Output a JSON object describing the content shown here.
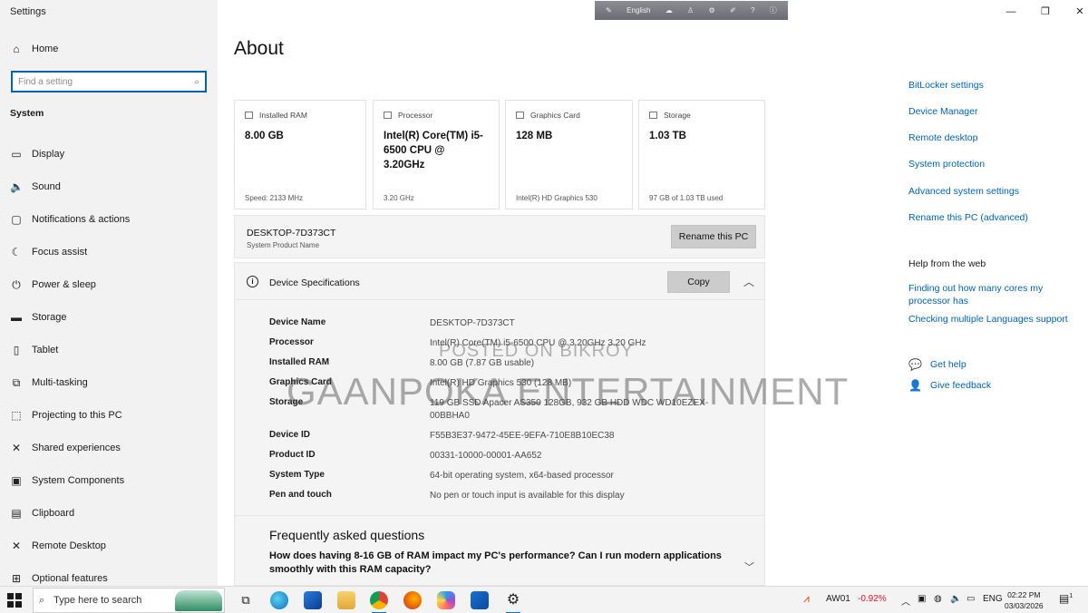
{
  "window": {
    "title": "Settings",
    "controls": [
      "—",
      "❐",
      "✕"
    ]
  },
  "langbar": {
    "language": "English"
  },
  "sidebar": {
    "home_label": "Home",
    "search_placeholder": "Find a setting",
    "section": "System",
    "items": [
      {
        "label": "Display",
        "icon": "monitor-icon",
        "glyph": "▭"
      },
      {
        "label": "Sound",
        "icon": "speaker-icon",
        "glyph": "🔈"
      },
      {
        "label": "Notifications & actions",
        "icon": "notification-icon",
        "glyph": "▢"
      },
      {
        "label": "Focus assist",
        "icon": "moon-icon",
        "glyph": "☾"
      },
      {
        "label": "Power & sleep",
        "icon": "power-icon",
        "glyph": "⏻"
      },
      {
        "label": "Storage",
        "icon": "storage-icon",
        "glyph": "▬"
      },
      {
        "label": "Tablet",
        "icon": "tablet-icon",
        "glyph": "▯"
      },
      {
        "label": "Multi-tasking",
        "icon": "multitask-icon",
        "glyph": "⧉"
      },
      {
        "label": "Projecting to this PC",
        "icon": "projector-icon",
        "glyph": "⬚"
      },
      {
        "label": "Shared experiences",
        "icon": "shared-icon",
        "glyph": "✕"
      },
      {
        "label": "System Components",
        "icon": "components-icon",
        "glyph": "▣"
      },
      {
        "label": "Clipboard",
        "icon": "clipboard-icon",
        "glyph": "▤"
      },
      {
        "label": "Remote Desktop",
        "icon": "remote-icon",
        "glyph": "✕"
      },
      {
        "label": "Optional features",
        "icon": "features-icon",
        "glyph": "⊞"
      }
    ]
  },
  "main": {
    "title": "About",
    "cards": [
      {
        "label": "Installed RAM",
        "value": "8.00 GB",
        "sub": "Speed: 2133 MHz"
      },
      {
        "label": "Processor",
        "value": "Intel(R) Core(TM) i5-6500 CPU @ 3.20GHz",
        "sub": "3.20 GHz"
      },
      {
        "label": "Graphics Card",
        "value": "128 MB",
        "sub": "Intel(R) HD Graphics 530"
      },
      {
        "label": "Storage",
        "value": "1.03 TB",
        "sub": "97 GB of 1.03 TB used"
      }
    ],
    "pc": {
      "name": "DESKTOP-7D373CT",
      "sub": "System Product Name",
      "rename_label": "Rename this PC"
    },
    "specs": {
      "title": "Device Specifications",
      "copy_label": "Copy",
      "rows": [
        {
          "k": "Device Name",
          "v": "DESKTOP-7D373CT"
        },
        {
          "k": "Processor",
          "v": "Intel(R) Core(TM) i5-6500 CPU @ 3.20GHz   3.20 GHz"
        },
        {
          "k": "Installed RAM",
          "v": "8.00 GB (7.87 GB usable)"
        },
        {
          "k": "Graphics Card",
          "v": "Intel(R) HD Graphics 530 (128 MB)"
        },
        {
          "k": "Storage",
          "v": "119 GB SSD Apacer AS350 128GB, 932 GB HDD WDC WD10EZEX-00BBHA0"
        },
        {
          "k": "Device ID",
          "v": "F55B3E37-9472-45EE-9EFA-710E8B10EC38"
        },
        {
          "k": "Product ID",
          "v": "00331-10000-00001-AA652"
        },
        {
          "k": "System Type",
          "v": "64-bit operating system, x64-based processor"
        },
        {
          "k": "Pen and touch",
          "v": "No pen or touch input is available for this display"
        }
      ]
    },
    "faq": {
      "heading": "Frequently asked questions",
      "question": "How does having 8-16 GB of RAM impact my PC's performance? Can I run modern applications smoothly with this RAM capacity?"
    }
  },
  "right": {
    "links": [
      "BitLocker settings",
      "Device Manager",
      "Remote desktop",
      "System protection",
      "Advanced system settings",
      "Rename this PC (advanced)"
    ],
    "help_heading": "Help from the web",
    "web_links": [
      "Finding out how many cores my processor has",
      "Checking multiple Languages support"
    ],
    "get_help": "Get help",
    "give_feedback": "Give feedback"
  },
  "watermark": {
    "line1": "POSTED ON BIKROY",
    "line2": "GAANPOKA ENTERTAINMENT"
  },
  "taskbar": {
    "search_placeholder": "Type here to search",
    "ticker": "AW01",
    "ticker_change": "-0.92%",
    "language": "ENG",
    "time": "02:22 PM",
    "date": "03/03/2026",
    "notif_count": "1",
    "colors": {
      "loss": "#e81123",
      "accent": "#0078d7"
    }
  }
}
